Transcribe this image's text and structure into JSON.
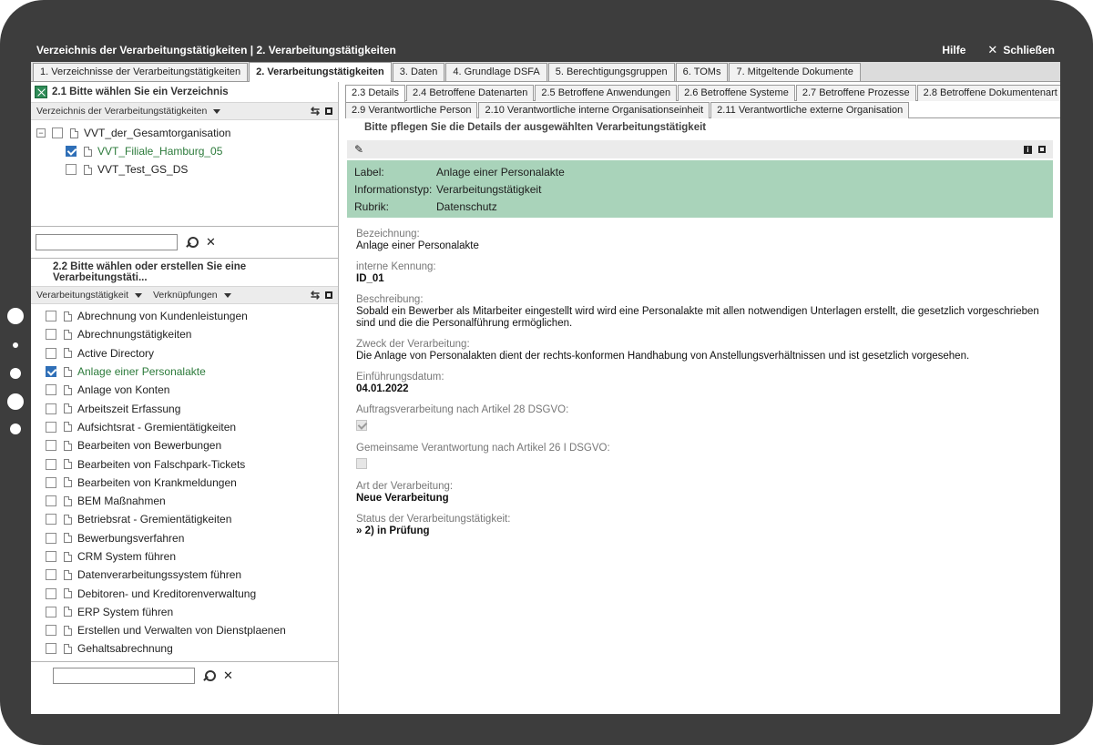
{
  "window": {
    "title": "Verzeichnis der Verarbeitungstätigkeiten | 2. Verarbeitungstätigkeiten",
    "help_label": "Hilfe",
    "close_label": "Schließen"
  },
  "main_tabs": [
    {
      "label": "1. Verzeichnisse der Verarbeitungstätigkeiten",
      "active": false
    },
    {
      "label": "2. Verarbeitungstätigkeiten",
      "active": true
    },
    {
      "label": "3. Daten",
      "active": false
    },
    {
      "label": "4. Grundlage DSFA",
      "active": false
    },
    {
      "label": "5. Berechtigungsgruppen",
      "active": false
    },
    {
      "label": "6. TOMs",
      "active": false
    },
    {
      "label": "7. Mitgeltende Dokumente",
      "active": false
    }
  ],
  "left": {
    "section1": {
      "title": "2.1 Bitte wählen Sie ein Verzeichnis",
      "dropdown": "Verzeichnis der Verarbeitungstätigkeiten",
      "tree": {
        "root": {
          "label": "VVT_der_Gesamtorganisation",
          "expander": "−"
        },
        "children": [
          {
            "label": "VVT_Filiale_Hamburg_05",
            "checked": true
          },
          {
            "label": "VVT_Test_GS_DS",
            "checked": false
          }
        ]
      },
      "search_value": ""
    },
    "section2": {
      "title": "2.2 Bitte wählen oder erstellen Sie eine Verarbeitungstäti...",
      "dropdown1": "Verarbeitungstätigkeit",
      "dropdown2": "Verknüpfungen",
      "items": [
        {
          "label": "Abrechnung von Kundenleistungen",
          "checked": false
        },
        {
          "label": "Abrechnungstätigkeiten",
          "checked": false
        },
        {
          "label": "Active Directory",
          "checked": false
        },
        {
          "label": "Anlage einer Personalakte",
          "checked": true
        },
        {
          "label": "Anlage von Konten",
          "checked": false
        },
        {
          "label": "Arbeitszeit Erfassung",
          "checked": false
        },
        {
          "label": "Aufsichtsrat - Gremientätigkeiten",
          "checked": false
        },
        {
          "label": "Bearbeiten von Bewerbungen",
          "checked": false
        },
        {
          "label": "Bearbeiten von Falschpark-Tickets",
          "checked": false
        },
        {
          "label": "Bearbeiten von Krankmeldungen",
          "checked": false
        },
        {
          "label": "BEM Maßnahmen",
          "checked": false
        },
        {
          "label": "Betriebsrat - Gremientätigkeiten",
          "checked": false
        },
        {
          "label": "Bewerbungsverfahren",
          "checked": false
        },
        {
          "label": "CRM System führen",
          "checked": false
        },
        {
          "label": "Datenverarbeitungssystem führen",
          "checked": false
        },
        {
          "label": "Debitoren- und Kreditorenverwaltung",
          "checked": false
        },
        {
          "label": "ERP System führen",
          "checked": false
        },
        {
          "label": "Erstellen und Verwalten von Dienstplaenen",
          "checked": false
        },
        {
          "label": "Gehaltsabrechnung",
          "checked": false
        }
      ],
      "search_value": ""
    }
  },
  "right": {
    "subtabs_row1": [
      {
        "label": "2.3 Details",
        "active": true
      },
      {
        "label": "2.4 Betroffene Datenarten",
        "active": false
      },
      {
        "label": "2.5 Betroffene Anwendungen",
        "active": false
      },
      {
        "label": "2.6 Betroffene Systeme",
        "active": false
      },
      {
        "label": "2.7 Betroffene Prozesse",
        "active": false
      },
      {
        "label": "2.8 Betroffene Dokumentenart",
        "active": false
      }
    ],
    "subtabs_row2": [
      {
        "label": "2.9 Verantwortliche Person",
        "active": false
      },
      {
        "label": "2.10 Verantwortliche interne Organisationseinheit",
        "active": false
      },
      {
        "label": "2.11 Verantwortliche externe Organisation",
        "active": false
      }
    ],
    "hint": "Bitte pflegen Sie die Details der ausgewählten Verarbeitungstätigkeit",
    "summary": [
      {
        "key": "Label:",
        "value": "Anlage einer Personalakte"
      },
      {
        "key": "Informationstyp:",
        "value": "Verarbeitungstätigkeit"
      },
      {
        "key": "Rubrik:",
        "value": "Datenschutz"
      }
    ],
    "fields": {
      "bezeichnung": {
        "label": "Bezeichnung:",
        "value": "Anlage einer Personalakte"
      },
      "kennung": {
        "label": "interne Kennung:",
        "value": "ID_01"
      },
      "beschreibung": {
        "label": "Beschreibung:",
        "value": "Sobald ein Bewerber als Mitarbeiter eingestellt wird wird eine Personalakte mit allen notwendigen Unterlagen erstellt, die gesetzlich vorgeschrieben sind und die die Personalführung ermöglichen."
      },
      "zweck": {
        "label": "Zweck der Verarbeitung:",
        "value": "Die Anlage von Personalakten dient der rechts-konformen Handhabung von Anstellungsverhältnissen und ist gesetzlich vorgesehen."
      },
      "datum": {
        "label": "Einführungsdatum:",
        "value": "04.01.2022"
      },
      "auftrag": {
        "label": "Auftragsverarbeitung nach Artikel 28 DSGVO:",
        "checked": true
      },
      "gemeinsam": {
        "label": "Gemeinsame Verantwortung nach Artikel 26 I DSGVO:",
        "checked": false
      },
      "art": {
        "label": "Art der Verarbeitung:",
        "value": "Neue Verarbeitung"
      },
      "status": {
        "label": "Status der Verarbeitungstätigkeit:",
        "value": "» 2) in Prüfung"
      }
    }
  },
  "colors": {
    "frame": "#3d3d3d",
    "summary_bg": "#a9d3ba",
    "selected_text": "#2b7a3a",
    "checkbox_checked": "#2f6fb7"
  }
}
